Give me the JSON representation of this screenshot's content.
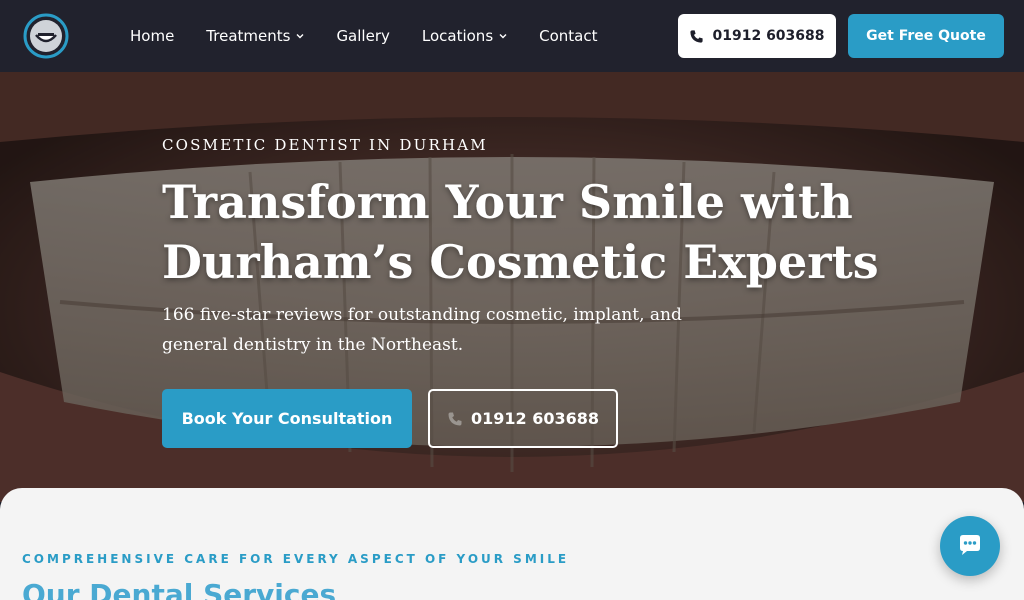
{
  "nav": {
    "items": [
      {
        "label": "Home",
        "has_dropdown": false
      },
      {
        "label": "Treatments",
        "has_dropdown": true
      },
      {
        "label": "Gallery",
        "has_dropdown": false
      },
      {
        "label": "Locations",
        "has_dropdown": true
      },
      {
        "label": "Contact",
        "has_dropdown": false
      }
    ],
    "phone_label": "01912 603688",
    "quote_label": "Get Free Quote"
  },
  "hero": {
    "eyebrow": "COSMETIC DENTIST IN DURHAM",
    "headline_line1": "Transform Your Smile with",
    "headline_line2": "Durham’s Cosmetic Experts",
    "subtext": "166 five-star reviews for outstanding cosmetic, implant, and general dentistry in the Northeast.",
    "book_label": "Book Your Consultation",
    "phone_label": "01912 603688"
  },
  "services": {
    "eyebrow": "COMPREHENSIVE CARE FOR EVERY ASPECT OF YOUR SMILE",
    "title": "Our Dental Services"
  },
  "icons": {
    "logo": "smile-logo-icon",
    "chevron": "chevron-down-icon",
    "phone": "phone-icon",
    "chat": "chat-bubble-icon"
  },
  "colors": {
    "nav_bg": "#21222d",
    "accent": "#2a9cc6",
    "services_bg": "#f4f4f4"
  }
}
